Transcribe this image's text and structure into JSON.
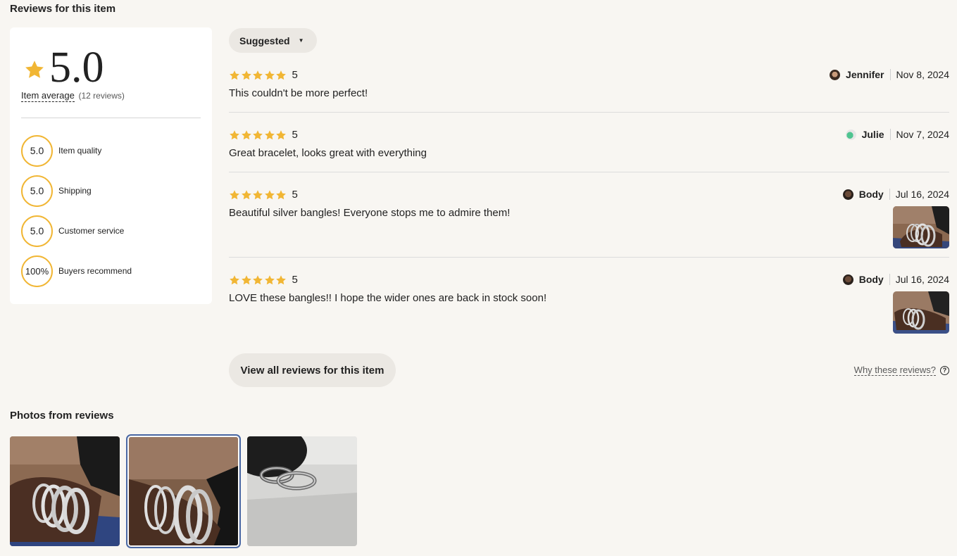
{
  "section_title": "Reviews for this item",
  "summary": {
    "rating": "5.0",
    "avg_label": "Item average",
    "review_count": "(12 reviews)",
    "metrics": [
      {
        "value": "5.0",
        "label": "Item quality"
      },
      {
        "value": "5.0",
        "label": "Shipping"
      },
      {
        "value": "5.0",
        "label": "Customer service"
      },
      {
        "value": "100%",
        "label": "Buyers recommend"
      }
    ]
  },
  "sort": {
    "label": "Suggested"
  },
  "reviews": [
    {
      "rating": "5",
      "text": "This couldn't be more perfect!",
      "reviewer": "Jennifer",
      "date": "Nov 8, 2024"
    },
    {
      "rating": "5",
      "text": "Great bracelet, looks great with everything",
      "reviewer": "Julie",
      "date": "Nov 7, 2024"
    },
    {
      "rating": "5",
      "text": "Beautiful silver bangles! Everyone stops me to admire them!",
      "reviewer": "Body",
      "date": "Jul 16, 2024"
    },
    {
      "rating": "5",
      "text": "LOVE these bangles!! I hope the wider ones are back in stock soon!",
      "reviewer": "Body",
      "date": "Jul 16, 2024"
    }
  ],
  "view_all_label": "View all reviews for this item",
  "why_label": "Why these reviews?",
  "photos_title": "Photos from reviews",
  "colors": {
    "star": "#f1b634",
    "background": "#f8f6f2",
    "selected_outline": "#4a68a4"
  }
}
